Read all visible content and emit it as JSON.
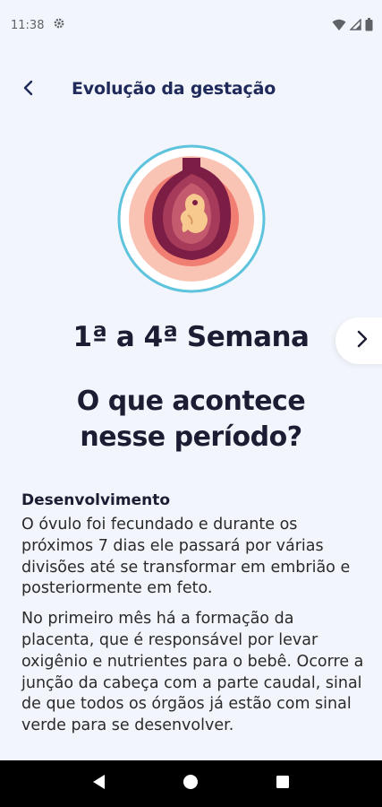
{
  "status_bar": {
    "time": "11:38",
    "icons": [
      "gear-icon",
      "wifi-icon",
      "signal-icon",
      "battery-icon"
    ]
  },
  "header": {
    "title": "Evolução da gestação",
    "back_icon": "chevron-left-icon"
  },
  "hero": {
    "illustration": "embryo-illustration",
    "colors": {
      "ring": "#5ec3dc",
      "outer": "#fac4b4",
      "middle": "#f07e72",
      "womb": "#7b1d44",
      "embryo": "#f7c98e"
    }
  },
  "week": {
    "title": "1ª a 4ª Semana",
    "next_icon": "chevron-right-icon"
  },
  "section": {
    "title_line1": "O que acontece",
    "title_line2": "nesse período?"
  },
  "content": {
    "heading": "Desenvolvimento",
    "paragraph1": "O óvulo foi fecundado e durante os próximos 7 dias ele passará por várias divisões até se transformar em embrião e posteriormente em feto.",
    "paragraph2": "No primeiro mês há a formação da placenta, que é responsável por levar oxigênio e nutrientes para o bebê. Ocorre a junção da cabeça com a parte caudal, sinal de que todos os órgãos já estão com sinal verde para se desenvolver."
  },
  "nav_bar": {
    "buttons": [
      "back-triangle-icon",
      "home-circle-icon",
      "recents-square-icon"
    ]
  },
  "colors": {
    "background": "#f2f5fc",
    "accent": "#1f2a5a",
    "text": "#1c1c33"
  }
}
